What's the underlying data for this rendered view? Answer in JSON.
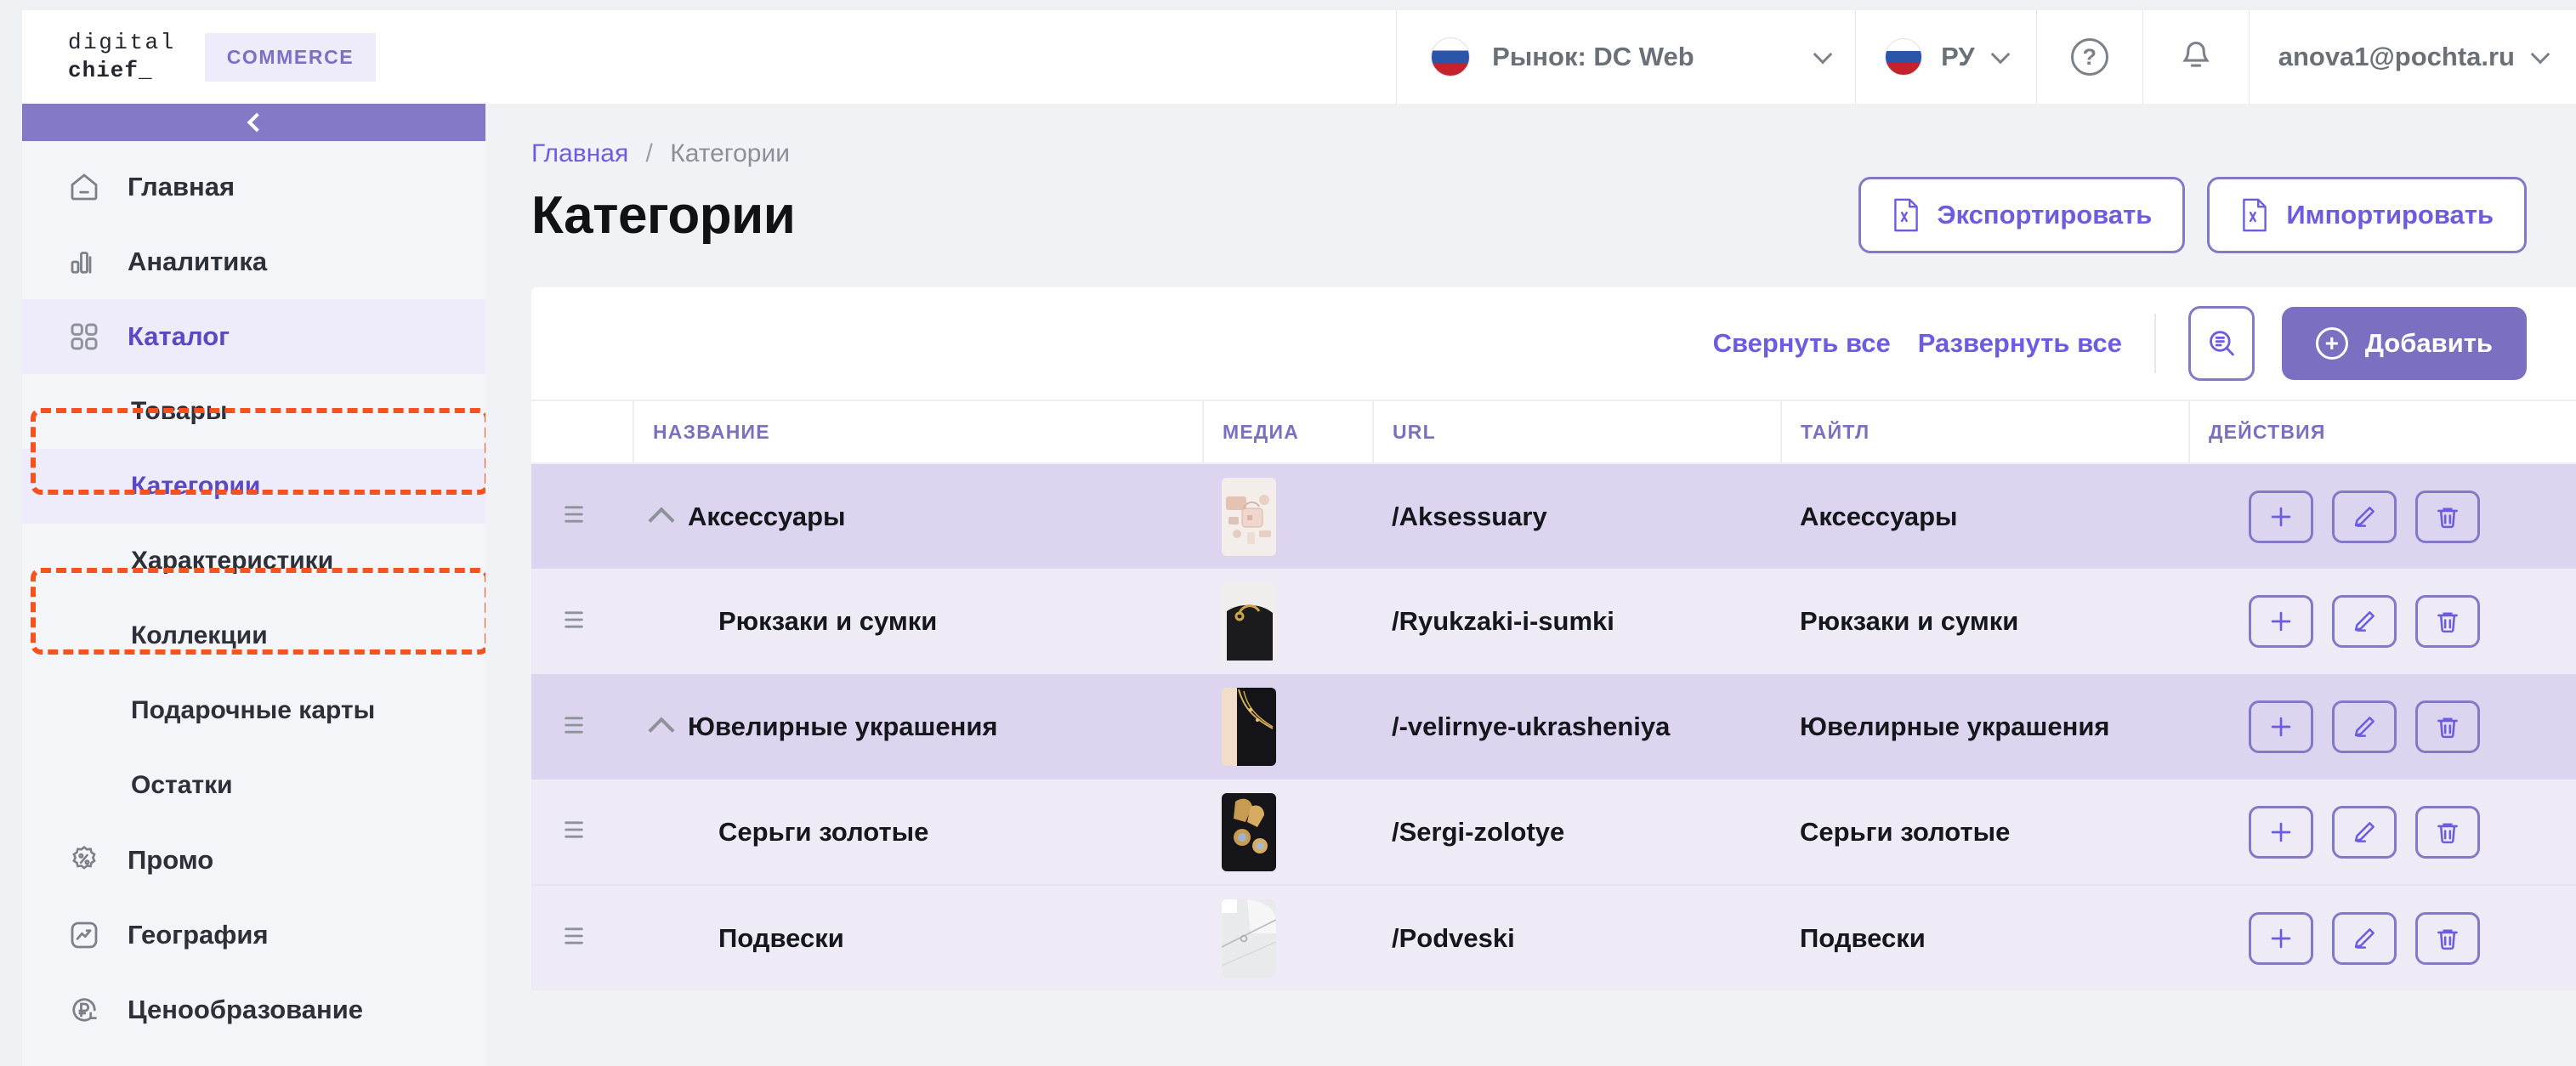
{
  "brand": {
    "logo_line1": "digital",
    "logo_line2": "chief_",
    "badge": "COMMERCE"
  },
  "topbar": {
    "market_label": "Рынок: DC Web",
    "language": "РУ",
    "help_icon": "?",
    "user_email": "anova1@pochta.ru"
  },
  "sidebar": {
    "collapse_label": "",
    "items": [
      {
        "label": "Главная",
        "icon": "home-icon",
        "level": "top",
        "active": false
      },
      {
        "label": "Аналитика",
        "icon": "analytics-icon",
        "level": "top",
        "active": false
      },
      {
        "label": "Каталог",
        "icon": "catalog-grid-icon",
        "level": "top",
        "active": true
      },
      {
        "label": "Товары",
        "icon": "",
        "level": "sub",
        "active": false
      },
      {
        "label": "Категории",
        "icon": "",
        "level": "sub",
        "active": true
      },
      {
        "label": "Характеристики",
        "icon": "",
        "level": "sub",
        "active": false
      },
      {
        "label": "Коллекции",
        "icon": "",
        "level": "sub",
        "active": false
      },
      {
        "label": "Подарочные карты",
        "icon": "",
        "level": "sub",
        "active": false
      },
      {
        "label": "Остатки",
        "icon": "",
        "level": "sub",
        "active": false
      },
      {
        "label": "Промо",
        "icon": "percent-badge-icon",
        "level": "top",
        "active": false
      },
      {
        "label": "География",
        "icon": "geography-icon",
        "level": "top",
        "active": false
      },
      {
        "label": "Ценообразование",
        "icon": "ruble-refresh-icon",
        "level": "top",
        "active": false
      }
    ]
  },
  "breadcrumb": {
    "home": "Главная",
    "separator": "/",
    "current": "Категории"
  },
  "page": {
    "title": "Категории",
    "export_label": "Экспортировать",
    "import_label": "Импортировать"
  },
  "toolbar": {
    "collapse_all": "Свернуть все",
    "expand_all": "Развернуть все",
    "search_icon": "search-list-icon",
    "add_label": "Добавить"
  },
  "table": {
    "columns": [
      "",
      "НАЗВАНИЕ",
      "МЕДИА",
      "URL",
      "ТАЙТЛ",
      "ДЕЙСТВИЯ"
    ],
    "rows": [
      {
        "name": "Аксессуары",
        "url": "/Aksessuary",
        "title": "Аксессуары",
        "level": "parent",
        "expanded": true,
        "media": "accessories-flatlay-thumb"
      },
      {
        "name": "Рюкзаки и сумки",
        "url": "/Ryukzaki-i-sumki",
        "title": "Рюкзаки и сумки",
        "level": "child",
        "expanded": false,
        "media": "black-bag-thumb"
      },
      {
        "name": "Ювелирные украшения",
        "url": "/-velirnye-ukrasheniya",
        "title": "Ювелирные украшения",
        "level": "parent",
        "expanded": true,
        "media": "gold-necklace-thumb"
      },
      {
        "name": "Серьги золотые",
        "url": "/Sergi-zolotye",
        "title": "Серьги золотые",
        "level": "child",
        "expanded": false,
        "media": "gold-earrings-thumb"
      },
      {
        "name": "Подвески",
        "url": "/Podveski",
        "title": "Подвески",
        "level": "child",
        "expanded": false,
        "media": "silver-pendant-thumb"
      }
    ],
    "row_actions": [
      "add-child",
      "edit",
      "delete"
    ]
  },
  "annotations": [
    {
      "target": "Каталог",
      "style": "orange-dashed-box"
    },
    {
      "target": "Категории",
      "style": "orange-dashed-box"
    }
  ],
  "colors": {
    "accent_purple": "#6c5ce0",
    "brand_purple": "#7b6fc2",
    "row_parent": "#ddd5ef",
    "row_child": "#eeebf7",
    "annotation_orange": "#f4531f"
  }
}
